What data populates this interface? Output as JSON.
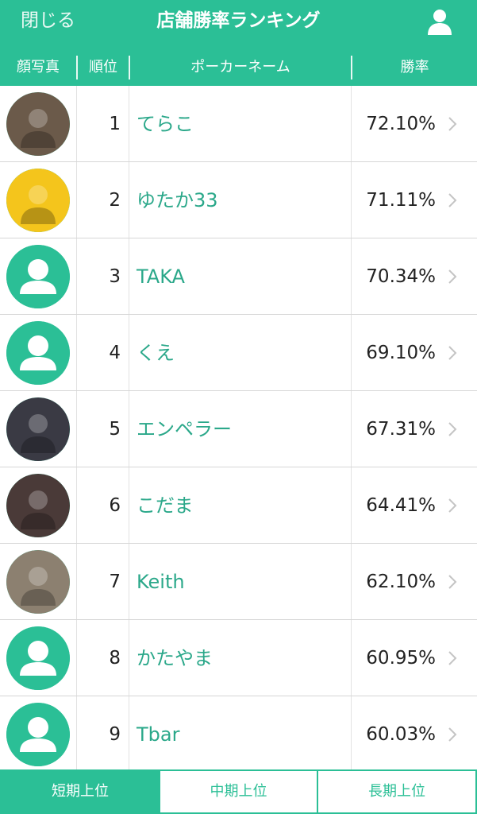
{
  "nav": {
    "close_label": "閉じる",
    "title": "店舗勝率ランキング",
    "user_icon": "user-icon"
  },
  "columns": {
    "photo": "顔写真",
    "rank": "順位",
    "name": "ポーカーネーム",
    "rate": "勝率"
  },
  "rows": [
    {
      "rank": "1",
      "name": "てらこ",
      "rate": "72.10%",
      "avatar": "photo"
    },
    {
      "rank": "2",
      "name": "ゆたか33",
      "rate": "71.11%",
      "avatar": "photo"
    },
    {
      "rank": "3",
      "name": "TAKA",
      "rate": "70.34%",
      "avatar": "default"
    },
    {
      "rank": "4",
      "name": "くえ",
      "rate": "69.10%",
      "avatar": "default"
    },
    {
      "rank": "5",
      "name": "エンペラー",
      "rate": "67.31%",
      "avatar": "photo"
    },
    {
      "rank": "6",
      "name": "こだま",
      "rate": "64.41%",
      "avatar": "photo"
    },
    {
      "rank": "7",
      "name": "Keith",
      "rate": "62.10%",
      "avatar": "photo"
    },
    {
      "rank": "8",
      "name": "かたやま",
      "rate": "60.95%",
      "avatar": "default"
    },
    {
      "rank": "9",
      "name": "Tbar",
      "rate": "60.03%",
      "avatar": "default"
    }
  ],
  "tabs": [
    {
      "label": "短期上位",
      "active": true
    },
    {
      "label": "中期上位",
      "active": false
    },
    {
      "label": "長期上位",
      "active": false
    }
  ],
  "colors": {
    "accent": "#2bbf96",
    "name_text": "#2ba88a",
    "divider": "#d6d6d6"
  }
}
